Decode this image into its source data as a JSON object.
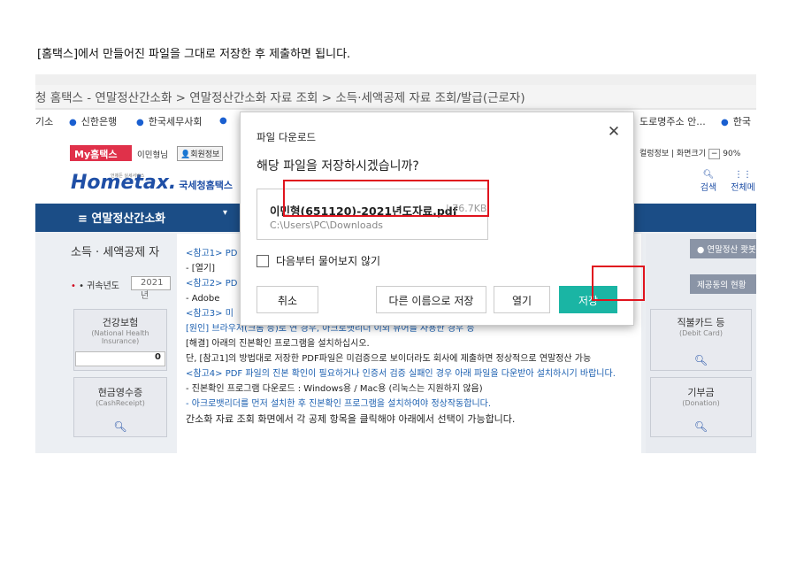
{
  "intro": "[홈택스]에서 만들어진 파일을 그대로 저장한 후 제출하면 됩니다.",
  "breadcrumb": "청 홈택스 - 연말정산간소화 > 연말정산간소화 자료 조회 > 소득·세액공제 자료 조회/발급(근로자)",
  "bookmarks": [
    "기소",
    "신한은행",
    "한국세무사회",
    "도로명주소 안...",
    "한국"
  ],
  "util": {
    "myhome": "My홈택스",
    "user": "이민형님",
    "user_info": "회원정보",
    "right": "컬렁정보 | 화면크기",
    "zoom": "90%"
  },
  "logo": {
    "main": "Hometax.",
    "sub": "국세청홈택스",
    "tiny": "언제든 실세서비스"
  },
  "header_icons": {
    "search": "검색",
    "all_menu": "전체메"
  },
  "nav": {
    "menu_label": "≡  연말정산간소화",
    "dropdown": "▾"
  },
  "left_panel": {
    "title": "소득 · 세액공제 자",
    "year_label": "• 귀속년도",
    "year_value": "2021년",
    "cards": [
      {
        "ko": "건강보험",
        "en": "(National Health Insurance)",
        "value": "0"
      },
      {
        "ko": "현금영수증",
        "en": "(CashReceipt)",
        "value": ""
      }
    ]
  },
  "right_panel": {
    "quick_button": "연말정산 쾃봇",
    "status_button": "제공동의 현황",
    "cards": [
      {
        "ko": "직불카드 등",
        "en": "(Debit Card)"
      },
      {
        "ko": "기부금",
        "en": "(Donation)"
      }
    ]
  },
  "main_panel": {
    "lines": [
      "<참고1> PD",
      "  - [열기]",
      "<참고2> PD",
      "  - Adobe",
      "<참고3> 미",
      "  [원인] 브라우저(크롬 등)로 연 경우, 아크로뱃리더 이외 뷰어를 사용한 경우 등",
      "  [해결] 아래의 진본확인 프로그램을 설치하십시오.",
      "  단, [참고1]의 방법대로 저장한 PDF파일은 미검증으로 보이더라도 회사에 제출하면 정상적으로 연말정산 가능",
      "<참고4> PDF 파일의 진본 확인이 필요하거나 인증서 검증 실패인 경우 아래 파일을 다운받아 설치하시기 바랍니다.",
      "  - 진본확인 프로그램 다운로드 : Windows용 / Mac용 (리눅스는 지원하지 않음)",
      "  - 아크로뱃리더를 먼저 설치한 후 진본확인 프로그램을 설치하여야 정상작동합니다.",
      "            간소화 자료 조회 화면에서 각 공제 항목을 클릭해야 아래에서 선택이 가능합니다."
    ]
  },
  "dialog": {
    "title": "파일 다운로드",
    "close": "✕",
    "question": "해당 파일을 저장하시겠습니까?",
    "file_name": "이민형(651120)-2021년도자료.pdf",
    "file_size": "| 76.7KB",
    "file_path": "C:\\Users\\PC\\Downloads",
    "checkbox_label": "다음부터 물어보지 않기",
    "buttons": {
      "cancel": "취소",
      "save_as": "다른 이름으로 저장",
      "open": "열기",
      "save": "저장"
    }
  },
  "colors": {
    "accent": "#1ab5a4",
    "highlight": "#e0141e",
    "nav": "#1b4d86"
  }
}
